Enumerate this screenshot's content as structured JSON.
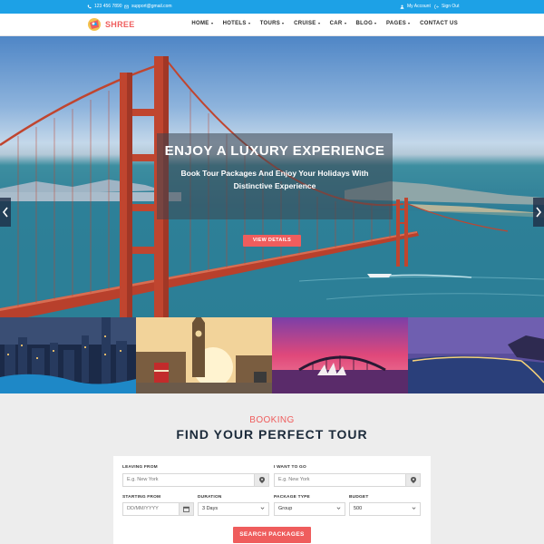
{
  "topbar": {
    "phone": "123 456 7890",
    "email": "support@gmail.com",
    "account": "My Account",
    "signout": "Sign Out"
  },
  "brand": {
    "name": "SHREE",
    "accent": "#ef5d5d",
    "topbar_color": "#1da1e6"
  },
  "nav": {
    "items": [
      {
        "label": "HOME",
        "dropdown": true
      },
      {
        "label": "HOTELS",
        "dropdown": true
      },
      {
        "label": "TOURS",
        "dropdown": true
      },
      {
        "label": "CRUISE",
        "dropdown": true
      },
      {
        "label": "CAR",
        "dropdown": true
      },
      {
        "label": "BLOG",
        "dropdown": true
      },
      {
        "label": "PAGES",
        "dropdown": true
      },
      {
        "label": "CONTACT US",
        "dropdown": false
      }
    ]
  },
  "hero": {
    "title": "ENJOY A LUXURY EXPERIENCE",
    "subtitle": "Book Tour Packages And Enjoy Your Holidays With Distinctive Experience",
    "button": "VIEW DETAILS",
    "prev_icon": "chevron-left-icon",
    "next_icon": "chevron-right-icon"
  },
  "booking": {
    "kicker": "BOOKING",
    "title": "FIND YOUR PERFECT TOUR",
    "leaving_from": {
      "label": "LEAVING FROM",
      "placeholder": "E.g. New York",
      "icon": "map-marker-icon"
    },
    "going_to": {
      "label": "I WANT TO GO",
      "placeholder": "E.g. New York",
      "icon": "map-marker-icon"
    },
    "starting_from": {
      "label": "STARTING FROM",
      "placeholder": "DD/MM/YYYY",
      "icon": "calendar-icon"
    },
    "duration": {
      "label": "DURATION",
      "value": "3 Days"
    },
    "package_type": {
      "label": "PACKAGE TYPE",
      "value": "Group"
    },
    "budget": {
      "label": "BUDGET",
      "value": "500"
    },
    "submit": "SEARCH PACKAGES"
  }
}
